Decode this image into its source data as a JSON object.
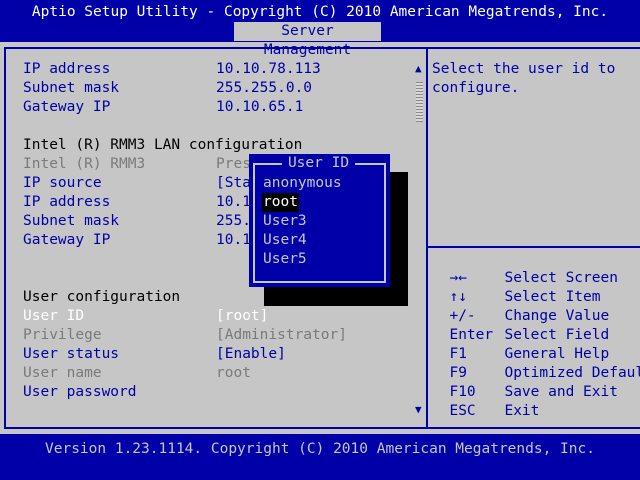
{
  "header": {
    "title": "Aptio Setup Utility - Copyright (C) 2010 American Megatrends, Inc.",
    "tab": "Server Management"
  },
  "settings": {
    "rows": [
      {
        "label": "IP address",
        "value": "10.10.78.113"
      },
      {
        "label": "Subnet mask",
        "value": "255.255.0.0"
      },
      {
        "label": "Gateway IP",
        "value": "10.10.65.1"
      },
      {
        "label": "Intel (R) RMM3 LAN configuration",
        "value": ""
      },
      {
        "label": "Intel (R) RMM3",
        "value": "Pres"
      },
      {
        "label": "IP source",
        "value": "[Sta"
      },
      {
        "label": "IP address",
        "value": "10.1"
      },
      {
        "label": "Subnet mask",
        "value": "255."
      },
      {
        "label": "Gateway IP",
        "value": "10.1"
      },
      {
        "label": "User configuration",
        "value": ""
      },
      {
        "label": "User ID",
        "value": "[root]"
      },
      {
        "label": "Privilege",
        "value": "[Administrator]"
      },
      {
        "label": "User status",
        "value": "[Enable]"
      },
      {
        "label": "User name",
        "value": "root"
      },
      {
        "label": "User password",
        "value": ""
      }
    ]
  },
  "popup": {
    "title": "User ID",
    "options": [
      "anonymous",
      "root",
      "User3",
      "User4",
      "User5"
    ],
    "selected": "root"
  },
  "help": {
    "text_line1": "Select the user id to",
    "text_line2": "configure."
  },
  "keys": [
    {
      "key": "→←",
      "action": "Select Screen"
    },
    {
      "key": "↑↓",
      "action": "Select Item"
    },
    {
      "key": "+/-",
      "action": "Change Value"
    },
    {
      "key": "Enter",
      "action": "Select Field"
    },
    {
      "key": "F1",
      "action": "General Help"
    },
    {
      "key": "F9",
      "action": "Optimized Defaults"
    },
    {
      "key": "F10",
      "action": "Save and Exit"
    },
    {
      "key": "ESC",
      "action": "Exit"
    }
  ],
  "footer": {
    "text": "Version 1.23.1114. Copyright (C) 2010 American Megatrends, Inc."
  },
  "colors": {
    "bios_blue": "#0000a8",
    "bios_gray": "#c6c6c6",
    "disabled_gray": "#7a7a7a"
  }
}
